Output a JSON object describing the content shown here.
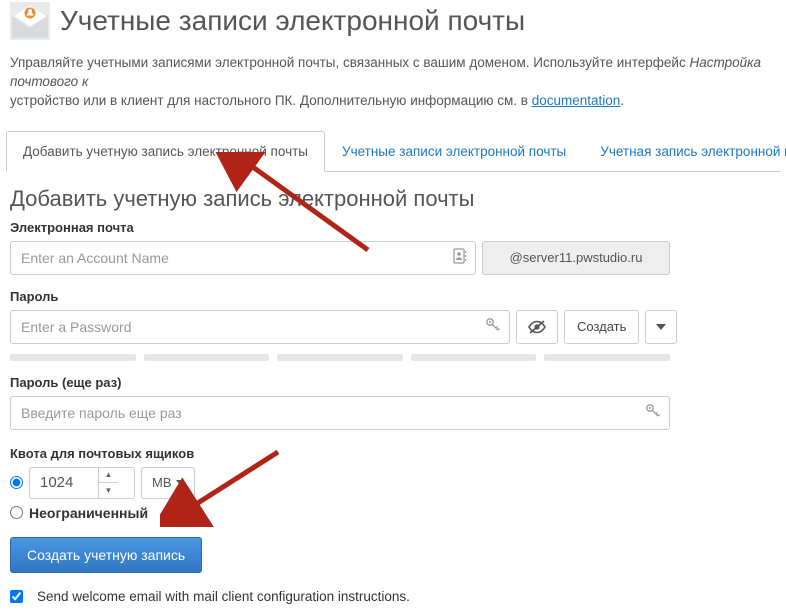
{
  "header": {
    "title": "Учетные записи электронной почты"
  },
  "intro": {
    "part1": "Управляйте учетными записями электронной почты, связанных с вашим доменом. Используйте интерфейс ",
    "em": "Настройка почтового к",
    "part2": " устройство или в клиент для настольного ПК. Дополнительную информацию см. в ",
    "link": "documentation",
    "part3": "."
  },
  "tabs": {
    "add": "Добавить учетную запись электронной почты",
    "list": "Учетные записи электронной почты",
    "default": "Учетная запись электронной почты по"
  },
  "section": {
    "title": "Добавить учетную запись электронной почты"
  },
  "form": {
    "email_label": "Электронная почта",
    "email_placeholder": "Enter an Account Name",
    "domain": "@server11.pwstudio.ru",
    "password_label": "Пароль",
    "password_placeholder": "Enter a Password",
    "generate": "Создать",
    "password2_label": "Пароль (еще раз)",
    "password2_placeholder": "Введите пароль еще раз",
    "quota_label": "Квота для почтовых ящиков",
    "quota_value": "1024",
    "quota_unit": "MB",
    "unlimited": "Неограниченный",
    "submit": "Создать учетную запись",
    "welcome": "Send welcome email with mail client configuration instructions."
  }
}
